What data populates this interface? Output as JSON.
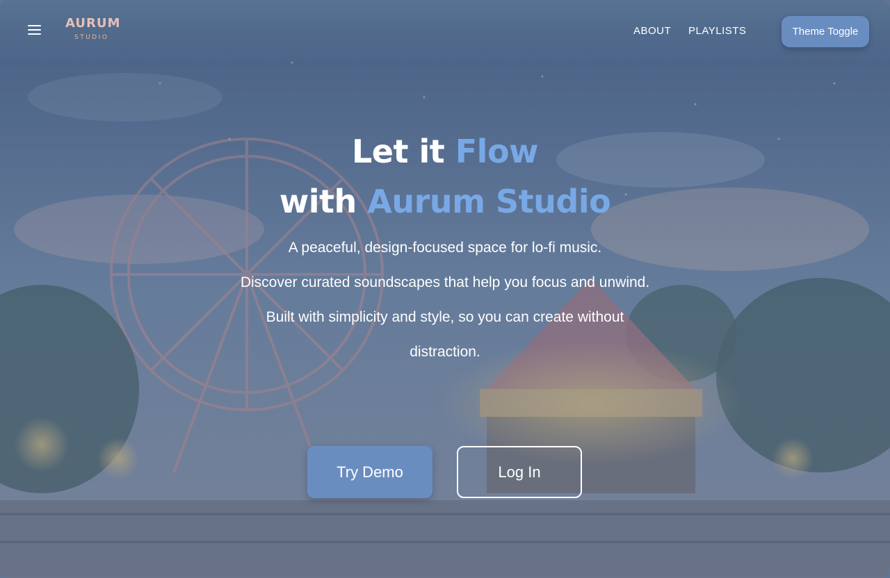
{
  "nav": {
    "logo_main": "AURUM",
    "logo_sub": "STUDIO",
    "links": [
      "ABOUT",
      "PLAYLISTS"
    ],
    "theme_toggle_label": "Theme Toggle",
    "menu_icon": "hamburger-menu-icon"
  },
  "hero": {
    "title_line1_prefix": "Let it ",
    "title_line1_highlight": "Flow",
    "title_line2_prefix": "with ",
    "title_line2_highlight": "Aurum Studio",
    "description": [
      "A peaceful, design-focused space for lo-fi music.",
      "Discover curated soundscapes that help you focus and unwind.",
      "Built with simplicity and style, so you can create without distraction."
    ],
    "primary_button": "Try Demo",
    "secondary_button": "Log In"
  },
  "colors": {
    "accent": "#79a8e6",
    "button": "#6a8dc0",
    "logo": "#e7c0b8"
  }
}
